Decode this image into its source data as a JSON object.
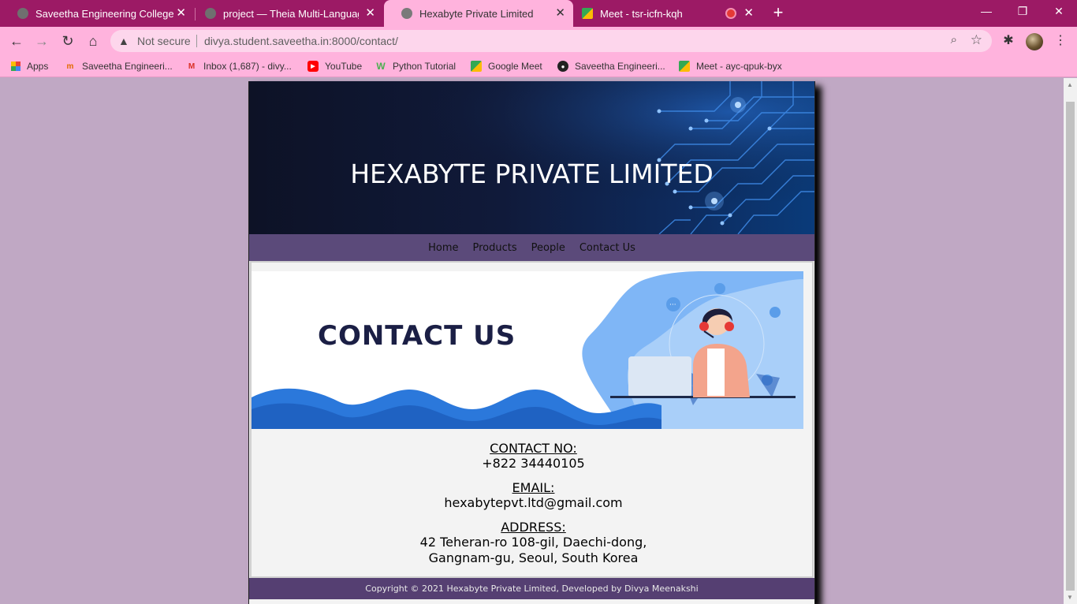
{
  "browser": {
    "tabs": [
      {
        "title": "Saveetha Engineering College",
        "favicon": "globe-icon"
      },
      {
        "title": "project — Theia Multi-Language",
        "favicon": "globe-icon"
      },
      {
        "title": "Hexabyte Private Limited",
        "favicon": "globe-icon",
        "active": true
      },
      {
        "title": "Meet - tsr-icfn-kqh",
        "favicon": "meet-icon"
      }
    ],
    "new_tab_label": "+",
    "window_controls": {
      "minimize": "—",
      "restore": "❐",
      "close": "✕"
    },
    "address": {
      "security_label": "Not secure",
      "url": "divya.student.saveetha.in:8000/contact/"
    },
    "bookmarks": [
      {
        "label": "Apps",
        "icon": "apps-grid-icon"
      },
      {
        "label": "Saveetha Engineeri...",
        "icon": "saveetha-icon"
      },
      {
        "label": "Inbox (1,687) - divy...",
        "icon": "gmail-icon"
      },
      {
        "label": "YouTube",
        "icon": "youtube-icon"
      },
      {
        "label": "Python Tutorial",
        "icon": "w3schools-icon"
      },
      {
        "label": "Google Meet",
        "icon": "meet-icon"
      },
      {
        "label": "Saveetha Engineeri...",
        "icon": "globe-icon"
      },
      {
        "label": "Meet - ayc-qpuk-byx",
        "icon": "meet-icon"
      }
    ]
  },
  "site": {
    "brand": "HEXABYTE PRIVATE LIMITED",
    "nav": [
      "Home",
      "Products",
      "People",
      "Contact Us"
    ],
    "hero_title": "CONTACT US",
    "contact_label": "CONTACT NO:",
    "contact_value": "+822 34440105",
    "email_label": "EMAIL:",
    "email_value": "hexabytepvt.ltd@gmail.com",
    "address_label": "ADDRESS:",
    "address_line1": "42 Teheran-ro 108-gil, Daechi-dong,",
    "address_line2": "Gangnam-gu, Seoul, South Korea",
    "footer": "Copyright © 2021 Hexabyte Private Limited, Developed by Divya Meenakshi"
  },
  "colors": {
    "tabstrip": "#9c1a65",
    "toolbar": "#ffb3dd",
    "page_bg": "#c0a8c4",
    "navbar": "#5b4a7a",
    "footer": "#553f72"
  }
}
